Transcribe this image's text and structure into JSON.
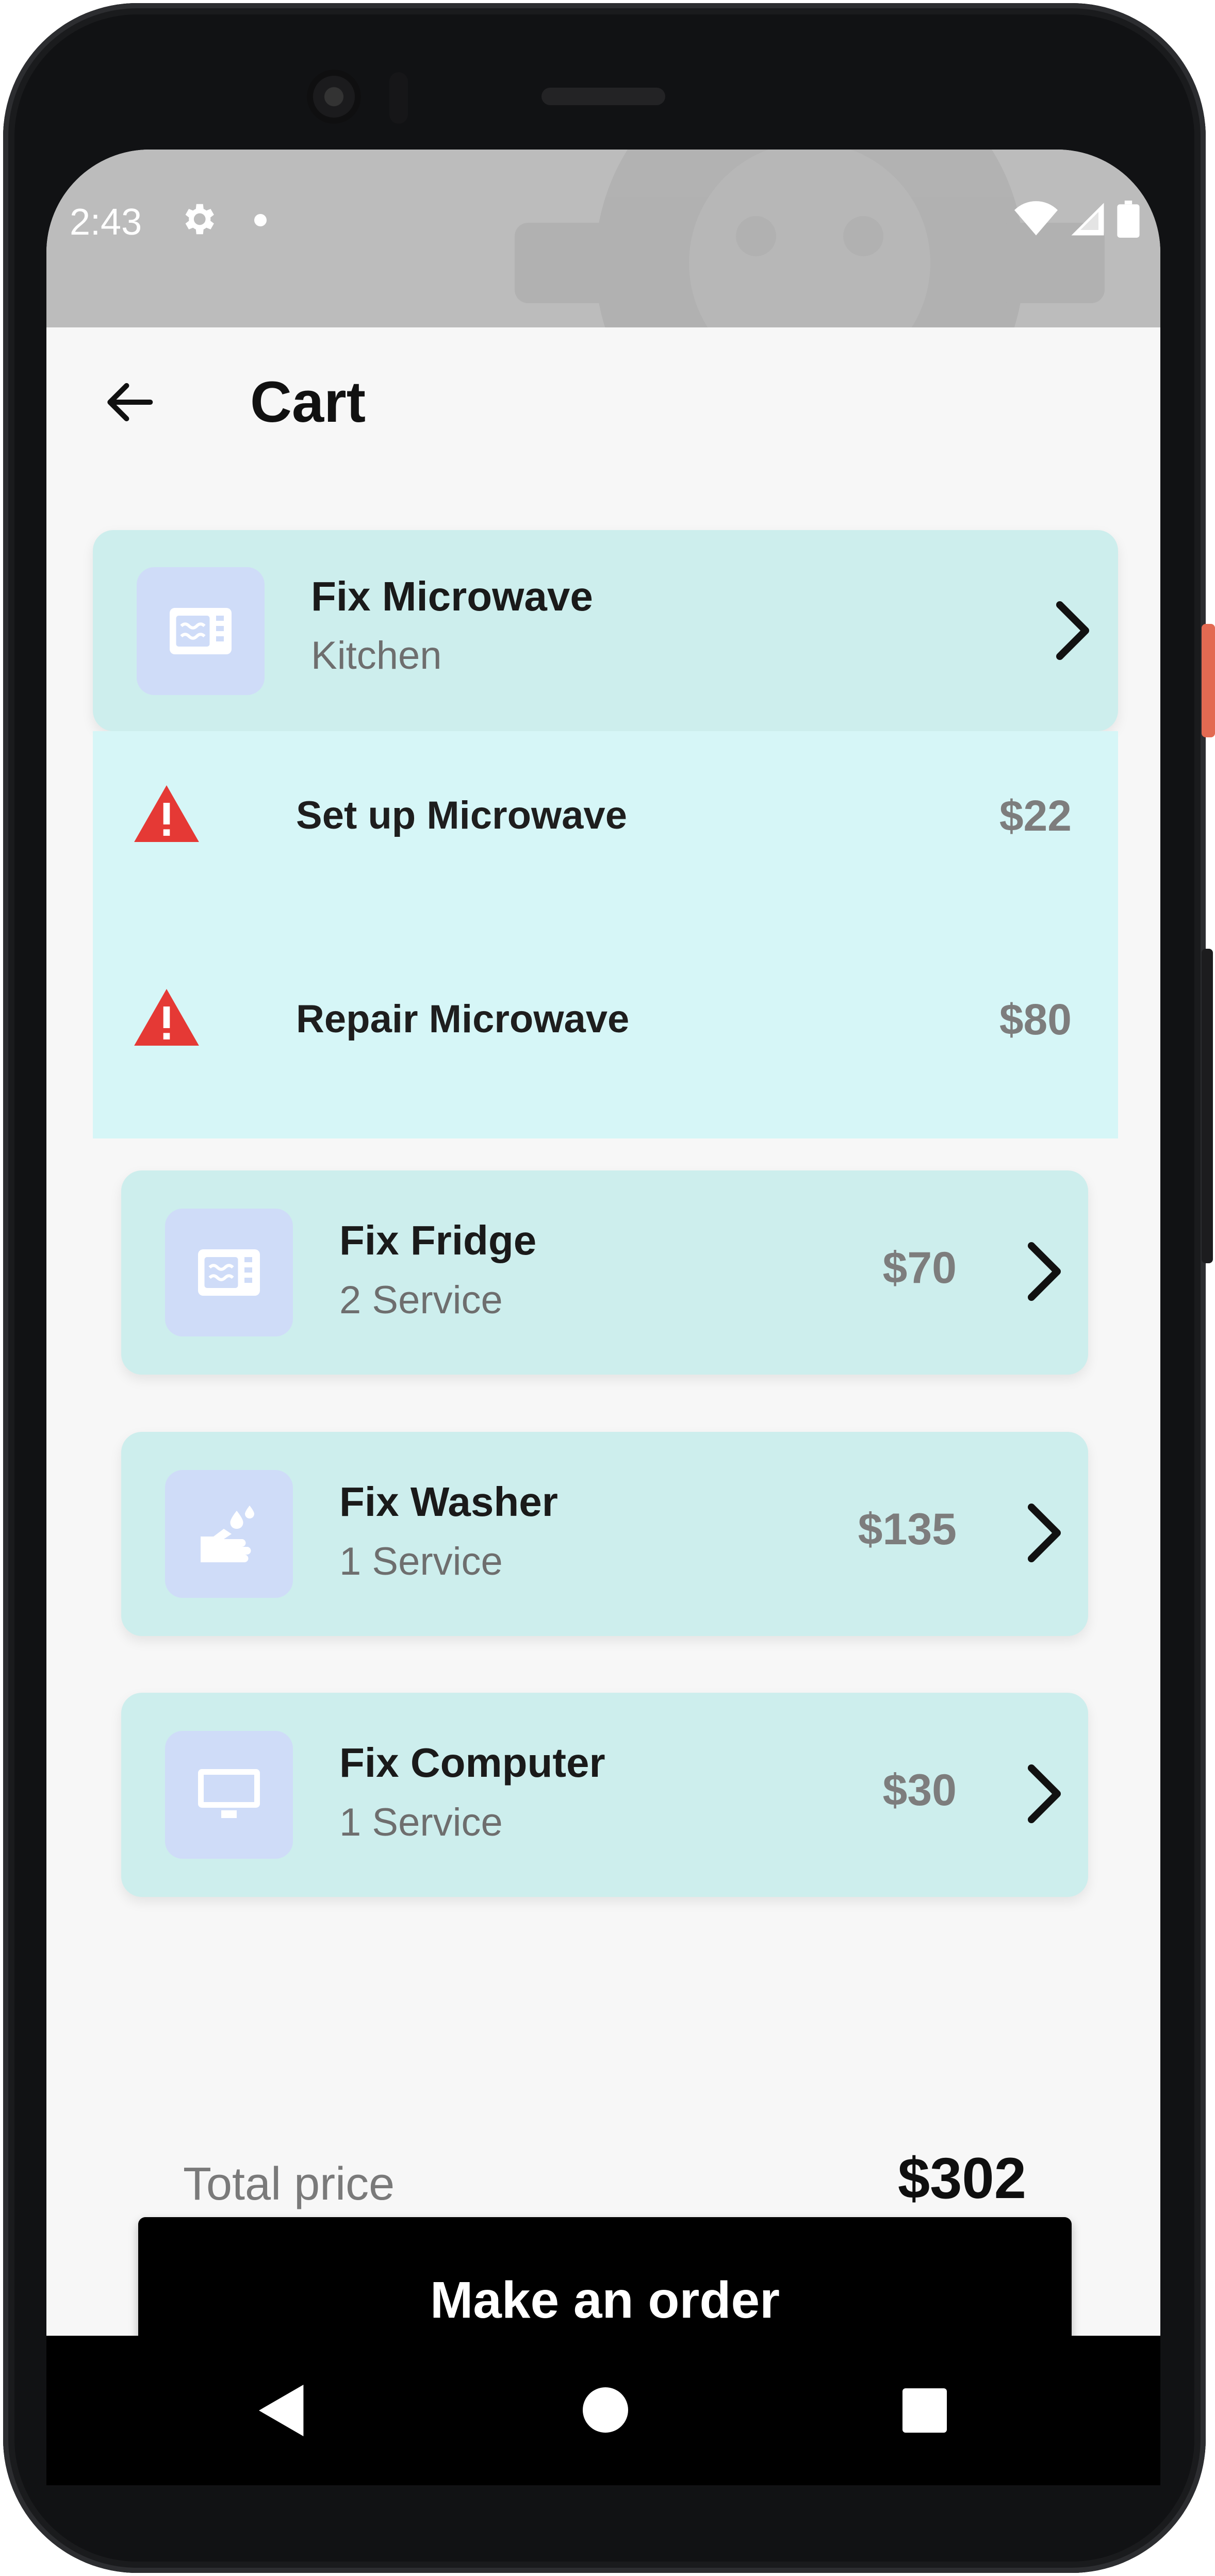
{
  "status_bar": {
    "time": "2:43"
  },
  "header": {
    "title": "Cart"
  },
  "groups": [
    {
      "name": "Fix Microwave",
      "subtitle": "Kitchen",
      "icon": "microwave-icon",
      "expanded": true,
      "services": [
        {
          "name": "Set up Microwave",
          "price": "$22",
          "icon": "warning-icon"
        },
        {
          "name": "Repair Microwave",
          "price": "$80",
          "icon": "warning-icon"
        }
      ]
    },
    {
      "name": "Fix Fridge",
      "subtitle": "2 Service",
      "price": "$70",
      "icon": "microwave-icon"
    },
    {
      "name": "Fix Washer",
      "subtitle": "1 Service",
      "price": "$135",
      "icon": "hand-wash-icon"
    },
    {
      "name": "Fix Computer",
      "subtitle": "1 Service",
      "price": "$30",
      "icon": "monitor-icon"
    }
  ],
  "summary": {
    "total_label": "Total price",
    "total_value": "$302"
  },
  "actions": {
    "order_label": "Make an order"
  },
  "colors": {
    "card_bg": "#cdeeed",
    "expanded_bg": "#d6f6f7",
    "icon_box_bg": "#cfdcf8",
    "warning": "#e53935",
    "primary_button": "#000000"
  }
}
